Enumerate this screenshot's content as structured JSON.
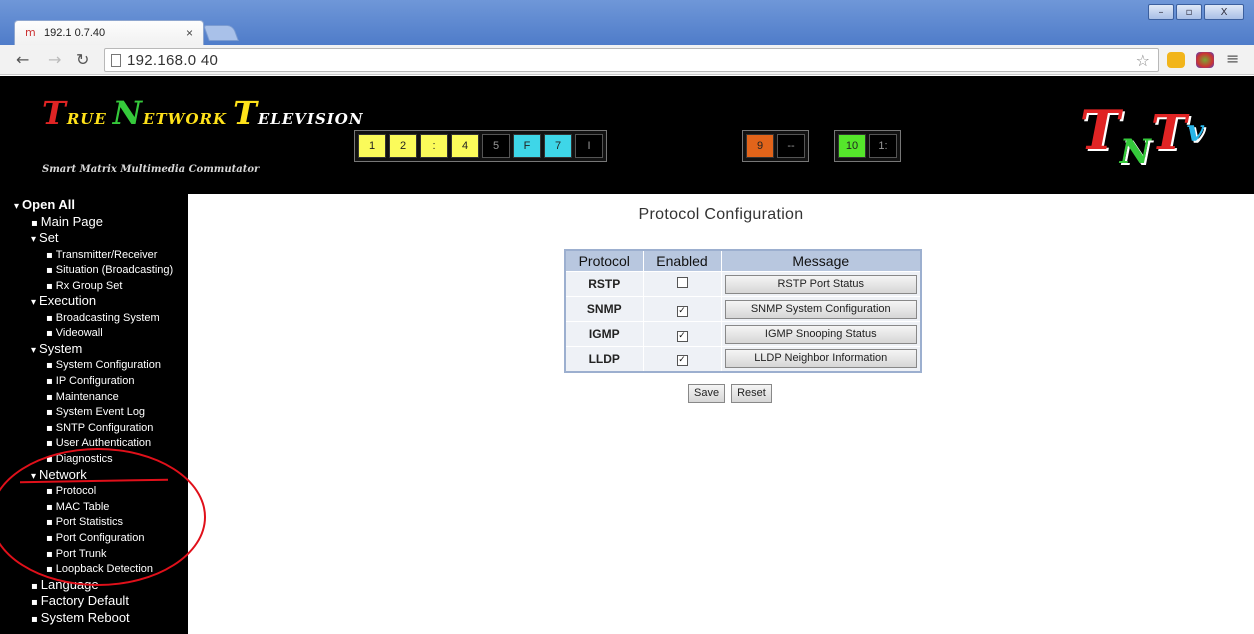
{
  "window": {
    "minimize": "–",
    "maximize": "▫",
    "close": "X"
  },
  "tab": {
    "title": "192.1 0.7.40",
    "close": "×"
  },
  "toolbar": {
    "url": "192.168.0 40"
  },
  "banner": {
    "brand": [
      {
        "cap": "T",
        "rest": "RUE",
        "capColor": "c-red",
        "restColor": "c-yel"
      },
      {
        "cap": "N",
        "rest": "ETWORK",
        "capColor": "c-grn",
        "restColor": "c-yel"
      },
      {
        "cap": "T",
        "rest": "ELEVISION",
        "capColor": "c-yel",
        "restColor": "c-wht"
      }
    ],
    "tagline": "Smart Matrix Multimedia Commutator",
    "channels_a": [
      {
        "label": "1",
        "color": "#fbfb5a"
      },
      {
        "label": "2",
        "color": "#fbfb5a"
      },
      {
        "label": ":",
        "color": "#fbfb5a"
      },
      {
        "label": "4",
        "color": "#fbfb5a"
      },
      {
        "label": "5",
        "color": "dark"
      },
      {
        "label": "F",
        "color": "#3ed6e8"
      },
      {
        "label": "7",
        "color": "#3ed6e8"
      },
      {
        "label": "I",
        "color": "dark"
      }
    ],
    "channels_b": [
      {
        "label": "9",
        "color": "#e2641a"
      },
      {
        "label": "--",
        "color": "dark"
      }
    ],
    "channels_c": [
      {
        "label": "10",
        "color": "#55e62b"
      },
      {
        "label": "1:",
        "color": "dark"
      }
    ],
    "logo": "TNTV"
  },
  "sidebar": {
    "items": [
      {
        "label": "Open All",
        "level": 0,
        "marker": "▾",
        "bold": true
      },
      {
        "label": "Main Page",
        "level": 1,
        "marker": "▪"
      },
      {
        "label": "Set",
        "level": 1,
        "marker": "▾"
      },
      {
        "label": "Transmitter/Receiver",
        "level": 2,
        "marker": "▪"
      },
      {
        "label": "Situation (Broadcasting)",
        "level": 2,
        "marker": "▪"
      },
      {
        "label": "Rx Group Set",
        "level": 2,
        "marker": "▪"
      },
      {
        "label": "Execution",
        "level": 1,
        "marker": "▾"
      },
      {
        "label": "Broadcasting System",
        "level": 2,
        "marker": "▪"
      },
      {
        "label": "Videowall",
        "level": 2,
        "marker": "▪"
      },
      {
        "label": "System",
        "level": 1,
        "marker": "▾"
      },
      {
        "label": "System Configuration",
        "level": 2,
        "marker": "▪"
      },
      {
        "label": "IP Configuration",
        "level": 2,
        "marker": "▪"
      },
      {
        "label": "Maintenance",
        "level": 2,
        "marker": "▪"
      },
      {
        "label": "System Event Log",
        "level": 2,
        "marker": "▪"
      },
      {
        "label": "SNTP Configuration",
        "level": 2,
        "marker": "▪"
      },
      {
        "label": "User Authentication",
        "level": 2,
        "marker": "▪"
      },
      {
        "label": "Diagnostics",
        "level": 2,
        "marker": "▪"
      },
      {
        "label": "Network",
        "level": 1,
        "marker": "▾"
      },
      {
        "label": "Protocol",
        "level": 2,
        "marker": "▪"
      },
      {
        "label": "MAC Table",
        "level": 2,
        "marker": "▪"
      },
      {
        "label": "Port Statistics",
        "level": 2,
        "marker": "▪"
      },
      {
        "label": "Port Configuration",
        "level": 2,
        "marker": "▪"
      },
      {
        "label": "Port Trunk",
        "level": 2,
        "marker": "▪"
      },
      {
        "label": "Loopback Detection",
        "level": 2,
        "marker": "▪"
      },
      {
        "label": "Language",
        "level": 1,
        "marker": "▪"
      },
      {
        "label": "Factory Default",
        "level": 1,
        "marker": "▪"
      },
      {
        "label": "System Reboot",
        "level": 1,
        "marker": "▪"
      }
    ]
  },
  "main": {
    "title": "Protocol Configuration",
    "headers": [
      "Protocol",
      "Enabled",
      "Message"
    ],
    "rows": [
      {
        "protocol": "RSTP",
        "enabled": false,
        "button": "RSTP Port Status"
      },
      {
        "protocol": "SNMP",
        "enabled": true,
        "button": "SNMP System Configuration"
      },
      {
        "protocol": "IGMP",
        "enabled": true,
        "button": "IGMP Snooping Status"
      },
      {
        "protocol": "LLDP",
        "enabled": true,
        "button": "LLDP Neighbor Information"
      }
    ],
    "save": "Save",
    "reset": "Reset"
  },
  "colors": {
    "annotation": "#e0101a",
    "table_header": "#b8c7df"
  }
}
